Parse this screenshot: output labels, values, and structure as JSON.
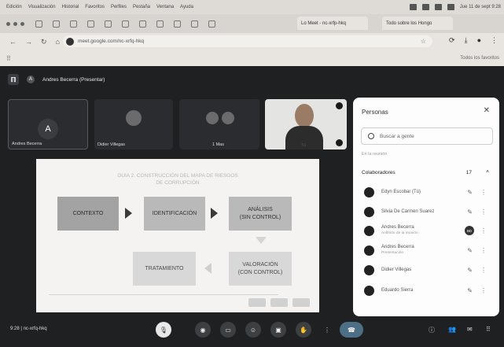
{
  "menubar": {
    "items": [
      "Edición",
      "Visualización",
      "Historial",
      "Favoritos",
      "Perfiles",
      "Pestaña",
      "Ventana",
      "Ayuda"
    ],
    "clock": "Jue 11 de sept 9:28"
  },
  "tabs": [
    {
      "label": "Lo Meet - nc-xrfp-hkq"
    },
    {
      "label": "Todo sobre los Hongo"
    }
  ],
  "address": {
    "url": "meet.google.com/nc-xrfq-hkq"
  },
  "bookmarks": {
    "all_label": "Todos los favoritos"
  },
  "meet": {
    "presenter": "Andres Becerra (Presentar)",
    "avatar_letter": "A",
    "tiles": [
      {
        "name": "Andres Becerra"
      },
      {
        "name": "Didier Villegas"
      },
      {
        "name": "1 Mas"
      },
      {
        "name": "Tú"
      }
    ],
    "slide": {
      "title": "GUIA 2. CONSTRUCCIÓN DEL MAPA DE RIESGOS\nDE CORRUPCIÓN",
      "boxes": {
        "contexto": "CONTEXTO",
        "identificacion": "IDENTIFICACIÓN",
        "analisis": "ANÁLISIS\n(SIN CONTROL)",
        "tratamiento": "TRATAMIENTO",
        "valoracion": "VALORACIÓN\n(CON CONTROL)"
      }
    },
    "people": {
      "title": "Personas",
      "search_placeholder": "Buscar a gente",
      "section": "En la reunión",
      "group_label": "Colaboradores",
      "group_count": "17",
      "list": [
        {
          "name": "Edyn Escobar (Tú)",
          "sub": ""
        },
        {
          "name": "Silvia De Carmen Suarez",
          "sub": ""
        },
        {
          "name": "Andres Becerra",
          "sub": "Anfitrión de la reunión",
          "badge": "BD"
        },
        {
          "name": "Andres Becerra",
          "sub": "Presentación"
        },
        {
          "name": "Didier Villegas",
          "sub": ""
        },
        {
          "name": "Eduardo Sierra",
          "sub": ""
        }
      ]
    },
    "bottom": {
      "meeting_info": "9:28 | nc-xrfq-hkq"
    }
  }
}
